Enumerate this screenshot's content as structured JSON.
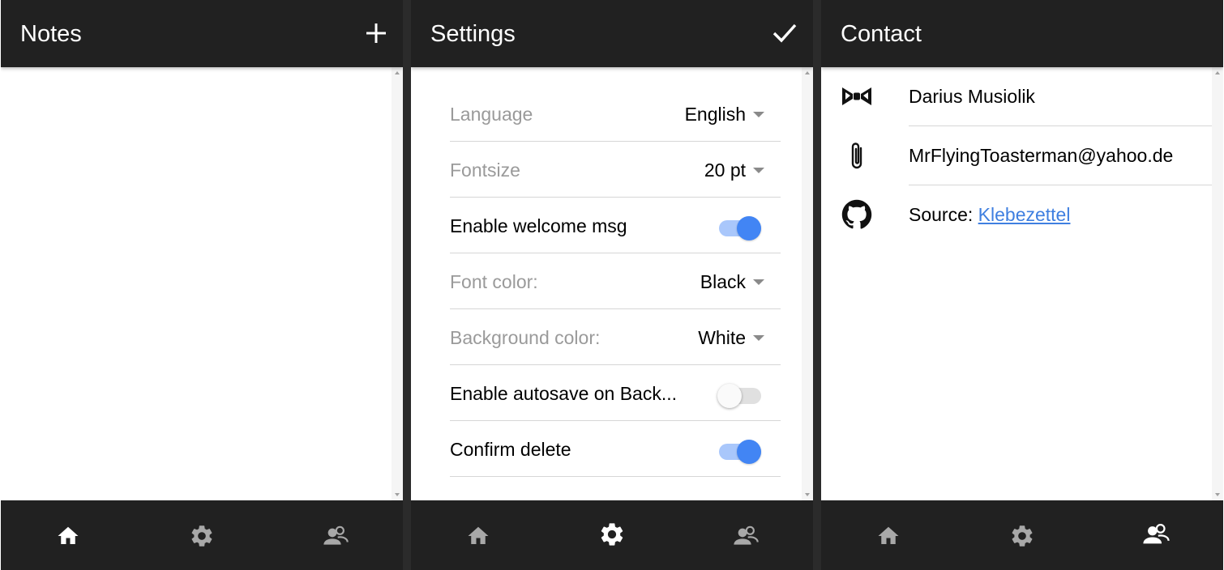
{
  "colors": {
    "bar_background": "#212121",
    "accent": "#4285f4",
    "link": "#3f7fe0"
  },
  "notes": {
    "title": "Notes",
    "action_icon": "plus-icon"
  },
  "settings": {
    "title": "Settings",
    "action_icon": "checkmark-icon",
    "rows": [
      {
        "label": "Language",
        "type": "select",
        "value": "English"
      },
      {
        "label": "Fontsize",
        "type": "select",
        "value": "20 pt"
      },
      {
        "label": "Enable welcome msg",
        "type": "toggle",
        "on": true
      },
      {
        "label": "Font color:",
        "type": "select",
        "value": "Black"
      },
      {
        "label": "Background color:",
        "type": "select",
        "value": "White"
      },
      {
        "label": "Enable autosave on Back...",
        "type": "toggle",
        "on": false
      },
      {
        "label": "Confirm delete",
        "type": "toggle",
        "on": true
      }
    ]
  },
  "contact": {
    "title": "Contact",
    "name": "Darius Musiolik",
    "email": "MrFlyingToasterman@yahoo.de",
    "source_label": "Source:",
    "source_link": "Klebezettel",
    "icons": [
      "bowtie-icon",
      "paperclip-icon",
      "github-icon"
    ]
  },
  "bottom_nav": {
    "items": [
      {
        "icon": "home-icon"
      },
      {
        "icon": "gear-icon"
      },
      {
        "icon": "contacts-icon"
      }
    ],
    "active_by_panel": [
      "home",
      "settings",
      "contact"
    ]
  }
}
